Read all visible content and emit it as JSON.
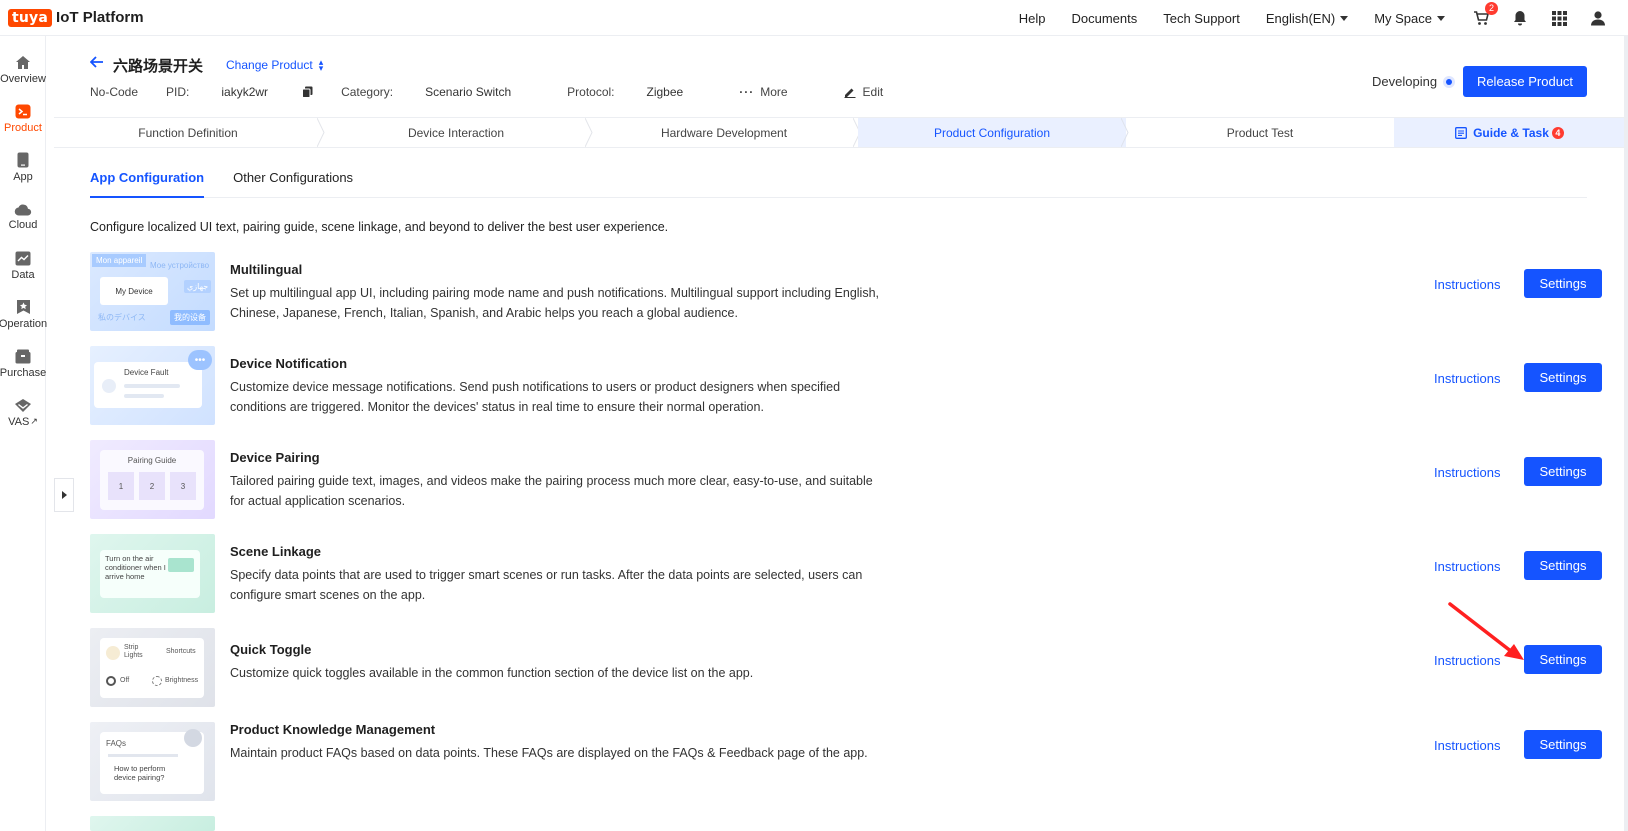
{
  "app": {
    "logo": "tuya",
    "name": "IoT Platform"
  },
  "topnav": {
    "help": "Help",
    "documents": "Documents",
    "tech_support": "Tech Support",
    "language": "English(EN)",
    "space": "My Space",
    "cart_count": "2"
  },
  "sidebar": {
    "items": [
      {
        "label": "Overview",
        "icon": "home-icon"
      },
      {
        "label": "Product",
        "icon": "product-icon"
      },
      {
        "label": "App",
        "icon": "phone-icon"
      },
      {
        "label": "Cloud",
        "icon": "cloud-icon"
      },
      {
        "label": "Data",
        "icon": "chart-icon"
      },
      {
        "label": "Operation",
        "icon": "operation-icon"
      },
      {
        "label": "Purchase",
        "icon": "box-icon"
      },
      {
        "label": "VAS",
        "icon": "vas-icon"
      }
    ]
  },
  "product": {
    "title": "六路场景开关",
    "change_label": "Change Product",
    "no_code": "No-Code",
    "pid_label": "PID:",
    "pid": "iakyk2wr",
    "category_label": "Category:",
    "category": "Scenario Switch",
    "protocol_label": "Protocol:",
    "protocol": "Zigbee",
    "more": "More",
    "edit": "Edit",
    "status": "Developing",
    "release": "Release Product"
  },
  "steps": [
    "Function Definition",
    "Device Interaction",
    "Hardware Development",
    "Product Configuration",
    "Product Test"
  ],
  "guide": {
    "label": "Guide & Task",
    "count": "4"
  },
  "tabs": [
    "App Configuration",
    "Other Configurations"
  ],
  "intro": "Configure localized UI text, pairing guide, scene linkage, and beyond to deliver the best user experience.",
  "rows": [
    {
      "title": "Multilingual",
      "desc": "Set up multilingual app UI, including pairing mode name and push notifications. Multilingual support including English, Chinese, Japanese, French, Italian, Spanish, and Arabic helps you reach a global audience.",
      "thumb_texts": [
        "Mon appareil",
        "Мое устройство",
        "My Device",
        "جهازي",
        "私のデバイス",
        "我的设备"
      ]
    },
    {
      "title": "Device Notification",
      "desc": "Customize device message notifications. Send push notifications to users or product designers when specified conditions are triggered. Monitor the devices' status in real time to ensure their normal operation.",
      "thumb_texts": [
        "Device Fault"
      ]
    },
    {
      "title": "Device Pairing",
      "desc": "Tailored pairing guide text, images, and videos make the pairing process much more clear, easy-to-use, and suitable for actual application scenarios.",
      "thumb_texts": [
        "Pairing Guide",
        "1",
        "2",
        "3"
      ]
    },
    {
      "title": "Scene Linkage",
      "desc": "Specify data points that are used to trigger smart scenes or run tasks. After the data points are selected, users can configure smart scenes on the app.",
      "thumb_texts": [
        "Turn on the air conditioner when I arrive home"
      ]
    },
    {
      "title": "Quick Toggle",
      "desc": "Customize quick toggles available in the common function section of the device list on the app.",
      "thumb_texts": [
        "Strip Lights",
        "Shortcuts",
        "Off",
        "Brightness"
      ]
    },
    {
      "title": "Product Knowledge Management",
      "desc": "Maintain product FAQs based on data points. These FAQs are displayed on the FAQs & Feedback page of the app.",
      "thumb_texts": [
        "FAQs",
        "How to perform device pairing?"
      ]
    }
  ],
  "actions": {
    "instructions": "Instructions",
    "settings": "Settings"
  },
  "colors": {
    "brand": "#ff4800",
    "primary": "#1554ff",
    "annotation_arrow": "#ff2020"
  }
}
